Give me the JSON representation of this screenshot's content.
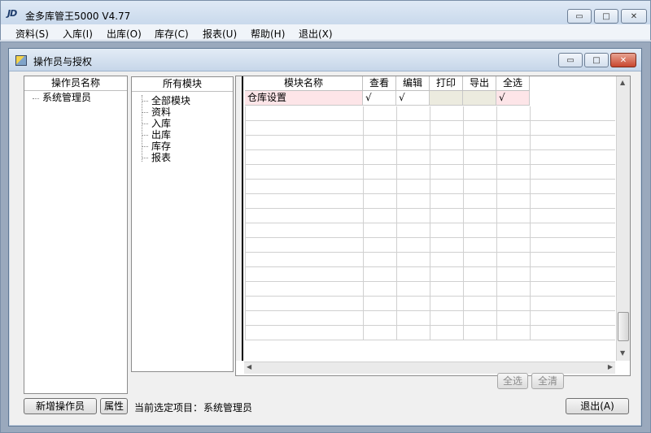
{
  "app": {
    "logo": "JD",
    "title": "金多库管王5000 V4.77"
  },
  "window_controls": {
    "minimize": "▭",
    "maximize": "□",
    "close": "✕"
  },
  "menu": [
    "资料(S)",
    "入库(I)",
    "出库(O)",
    "库存(C)",
    "报表(U)",
    "帮助(H)",
    "退出(X)"
  ],
  "child": {
    "title": "操作员与授权"
  },
  "operators": {
    "header": "操作员名称",
    "items": [
      "系统管理员"
    ]
  },
  "modules": {
    "header": "所有模块",
    "items": [
      "全部模块",
      "资料",
      "入库",
      "出库",
      "库存",
      "报表"
    ]
  },
  "grid": {
    "columns": [
      "模块名称",
      "查看",
      "编辑",
      "打印",
      "导出",
      "全选"
    ],
    "rows": [
      {
        "name": "仓库设置",
        "view": "√",
        "edit": "√",
        "print": "",
        "export": "",
        "all": "√"
      }
    ]
  },
  "buttons": {
    "select_all": "全选",
    "clear_all": "全清",
    "add_operator": "新增操作员",
    "properties": "属性",
    "exit": "退出(A)"
  },
  "status": {
    "label": "当前选定项目：",
    "value": "系统管理员"
  },
  "colors": {
    "highlight_row": "#fde5e8",
    "disabled_cell": "#ecebdf"
  }
}
